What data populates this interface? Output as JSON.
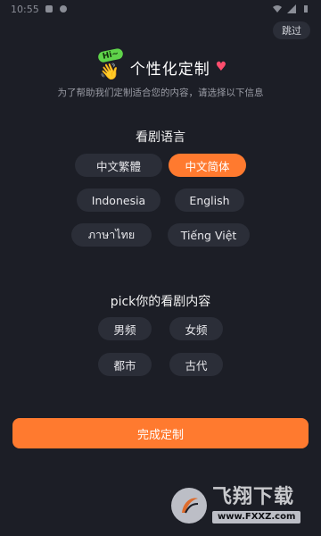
{
  "status_bar": {
    "time": "10:55"
  },
  "skip_label": "跳过",
  "header": {
    "hi_text": "Hi~",
    "title": "个性化定制",
    "subtitle": "为了帮助我们定制适合您的内容，请选择以下信息"
  },
  "language_section": {
    "title": "看剧语言",
    "options": [
      {
        "label": "中文繁體",
        "selected": false
      },
      {
        "label": "中文简体",
        "selected": true
      },
      {
        "label": "Indonesia",
        "selected": false
      },
      {
        "label": "English",
        "selected": false
      },
      {
        "label": "ภาษาไทย",
        "selected": false
      },
      {
        "label": "Tiếng Việt",
        "selected": false
      }
    ]
  },
  "content_section": {
    "title": "pick你的看剧内容",
    "options": [
      {
        "label": "男频",
        "selected": false
      },
      {
        "label": "女频",
        "selected": false
      },
      {
        "label": "都市",
        "selected": false
      },
      {
        "label": "古代",
        "selected": false
      }
    ]
  },
  "complete_button_label": "完成定制",
  "watermark": {
    "main": "飞翔下载",
    "url": "www.FXXZ.com"
  },
  "colors": {
    "background": "#1c1e26",
    "accent": "#ff7a2f",
    "chip": "#2b2e38"
  }
}
